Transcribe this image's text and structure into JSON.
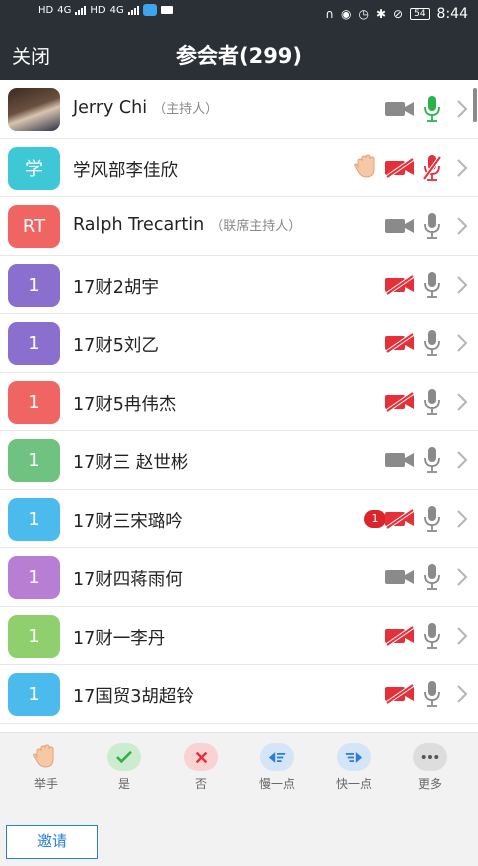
{
  "status_bar": {
    "left_labels": [
      "HD",
      "4G",
      "HD",
      "4G"
    ],
    "right_icons": [
      "headset-icon",
      "eye-icon",
      "alarm-icon",
      "bluetooth-icon",
      "mute-icon"
    ],
    "battery": "54",
    "time": "8:44"
  },
  "header": {
    "close_label": "关闭",
    "title": "参会者(299)"
  },
  "participants": [
    {
      "avatar_text": "",
      "avatar_color": "#3a2a20",
      "name": "Jerry Chi",
      "role": "（主持人）",
      "hand": false,
      "badge": "",
      "video_on": false,
      "video_muted": false,
      "mic": "green"
    },
    {
      "avatar_text": "学",
      "avatar_color": "#3ec8d6",
      "name": "学风部李佳欣",
      "role": "",
      "hand": true,
      "badge": "",
      "video_muted": true,
      "mic": "red"
    },
    {
      "avatar_text": "RT",
      "avatar_color": "#f06461",
      "name": "Ralph Trecartin",
      "role": "（联席主持人）",
      "hand": false,
      "badge": "",
      "video_muted": false,
      "mic": "gray"
    },
    {
      "avatar_text": "1",
      "avatar_color": "#8a6fcf",
      "name": "17财2胡宇",
      "role": "",
      "hand": false,
      "badge": "",
      "video_muted": true,
      "mic": "gray"
    },
    {
      "avatar_text": "1",
      "avatar_color": "#8a6fcf",
      "name": "17财5刘乙",
      "role": "",
      "hand": false,
      "badge": "",
      "video_muted": true,
      "mic": "gray"
    },
    {
      "avatar_text": "1",
      "avatar_color": "#f06461",
      "name": "17财5冉伟杰",
      "role": "",
      "hand": false,
      "badge": "",
      "video_muted": true,
      "mic": "gray"
    },
    {
      "avatar_text": "1",
      "avatar_color": "#6fc27f",
      "name": "17财三 赵世彬",
      "role": "",
      "hand": false,
      "badge": "",
      "video_muted": false,
      "mic": "gray"
    },
    {
      "avatar_text": "1",
      "avatar_color": "#4bbbed",
      "name": "17财三宋璐吟",
      "role": "",
      "hand": false,
      "badge": "1",
      "video_muted": true,
      "mic": "gray"
    },
    {
      "avatar_text": "1",
      "avatar_color": "#b77ed4",
      "name": "17财四蒋雨何",
      "role": "",
      "hand": false,
      "badge": "",
      "video_muted": false,
      "mic": "gray"
    },
    {
      "avatar_text": "1",
      "avatar_color": "#8fcf6e",
      "name": "17财一李丹",
      "role": "",
      "hand": false,
      "badge": "",
      "video_muted": true,
      "mic": "gray"
    },
    {
      "avatar_text": "1",
      "avatar_color": "#4bbbed",
      "name": "17国贸3胡超铃",
      "role": "",
      "hand": false,
      "badge": "",
      "video_muted": true,
      "mic": "gray"
    },
    {
      "avatar_text": "",
      "avatar_color": "#f06461",
      "name": "",
      "role": "",
      "hand": false,
      "badge": "",
      "video_muted": false,
      "mic": "none"
    }
  ],
  "reactions": [
    {
      "label": "举手",
      "icon": "raise-hand-icon",
      "color": "#f2f2f2"
    },
    {
      "label": "是",
      "icon": "check-icon",
      "color": "#cdeccf"
    },
    {
      "label": "否",
      "icon": "x-icon",
      "color": "#f9d2d2"
    },
    {
      "label": "慢一点",
      "icon": "slower-icon",
      "color": "#d3e5f7"
    },
    {
      "label": "快一点",
      "icon": "faster-icon",
      "color": "#d3e5f7"
    },
    {
      "label": "更多",
      "icon": "more-icon",
      "color": "#dddddd"
    }
  ],
  "invite_label": "邀请"
}
